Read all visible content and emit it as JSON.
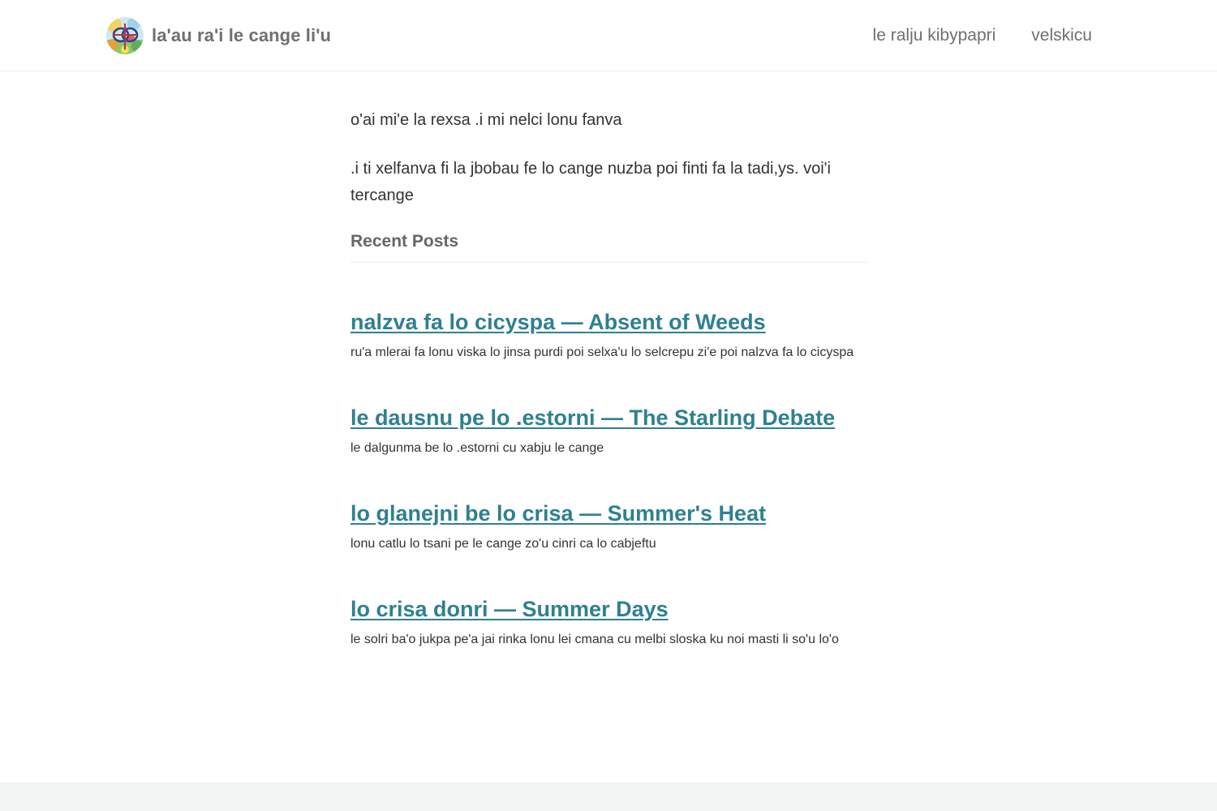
{
  "header": {
    "site_title": "la'au ra'i le cange li'u",
    "nav": [
      {
        "label": "le ralju kibypapri"
      },
      {
        "label": "velskicu"
      }
    ]
  },
  "intro": {
    "paragraphs": [
      "o'ai mi'e la rexsa .i mi nelci lonu fanva",
      ".i ti xelfanva fi la jbobau fe lo cange nuzba poi finti fa la tadi,ys. voi'i tercange"
    ]
  },
  "recent_posts": {
    "heading": "Recent Posts",
    "items": [
      {
        "title": "nalzva fa lo cicyspa — Absent of Weeds",
        "summary": "ru'a mlerai fa lonu viska lo jinsa purdi poi selxa'u lo selcrepu zi'e poi nalzva fa lo cicyspa"
      },
      {
        "title": "le dausnu pe lo .estorni — The Starling Debate",
        "summary": "le dalgunma be lo .estorni cu xabju le cange"
      },
      {
        "title": "lo glanejni be lo crisa — Summer's Heat",
        "summary": "lonu catlu lo tsani pe le cange zo'u cinri ca lo cabjeftu"
      },
      {
        "title": "lo crisa donri — Summer Days",
        "summary": "le solri ba'o jukpa pe'a jai rinka lonu lei cmana cu melbi sloska ku noi masti li so'u lo'o"
      }
    ]
  },
  "colors": {
    "link": "#2e8092",
    "muted": "#6f6f6f",
    "text": "#333333",
    "footer_bg": "#f2f3f3"
  }
}
